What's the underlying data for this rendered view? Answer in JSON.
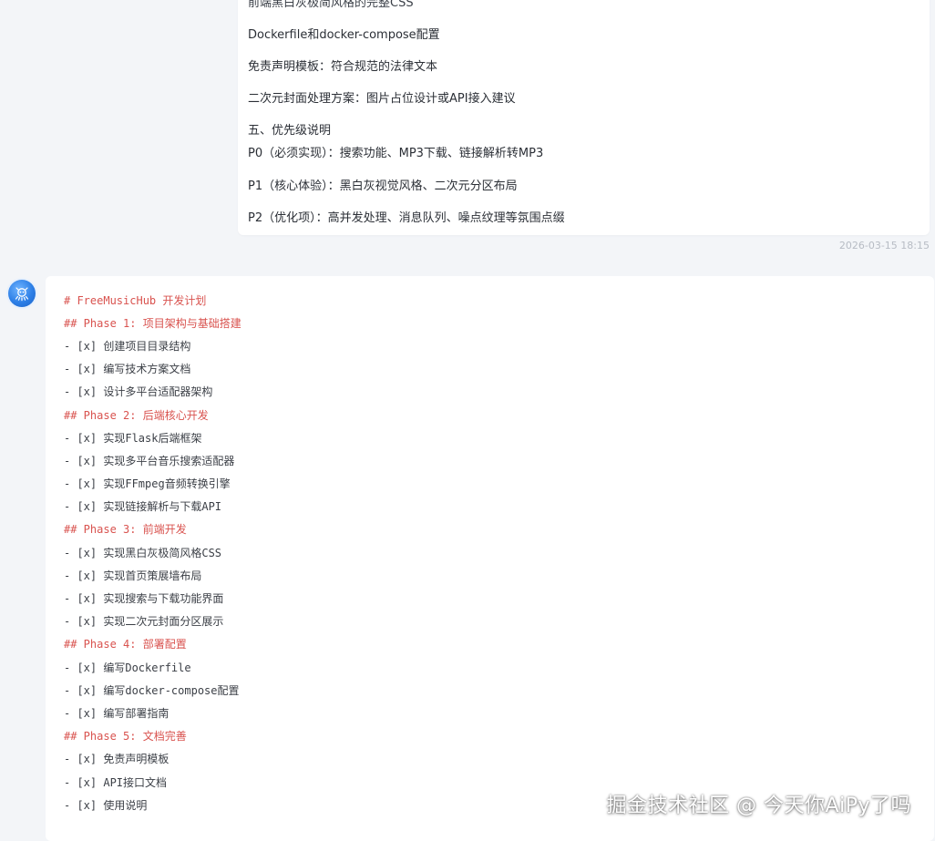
{
  "user_message": {
    "partial_top": "前端黑白灰极简风格的完整CSS",
    "lines": [
      "Dockerfile和docker-compose配置",
      "免责声明模板：符合规范的法律文本",
      "二次元封面处理方案：图片占位设计或API接入建议",
      "五、优先级说明",
      "P0（必须实现）：搜索功能、MP3下载、链接解析转MP3",
      "P1（核心体验）：黑白灰视觉风格、二次元分区布局",
      "P2（优化项）：高并发处理、消息队列、噪点纹理等氛围点缀"
    ],
    "timestamp": "2026-03-15 18:15"
  },
  "assistant_message": {
    "lines": [
      {
        "type": "heading",
        "text": "# FreeMusicHub 开发计划"
      },
      {
        "type": "heading",
        "text": "## Phase 1: 项目架构与基础搭建"
      },
      {
        "type": "task",
        "text": "- [x] 创建项目目录结构"
      },
      {
        "type": "task",
        "text": "- [x] 编写技术方案文档"
      },
      {
        "type": "task",
        "text": "- [x] 设计多平台适配器架构"
      },
      {
        "type": "heading",
        "text": "## Phase 2: 后端核心开发"
      },
      {
        "type": "task",
        "text": "- [x] 实现Flask后端框架"
      },
      {
        "type": "task",
        "text": "- [x] 实现多平台音乐搜索适配器"
      },
      {
        "type": "task",
        "text": "- [x] 实现FFmpeg音频转换引擎"
      },
      {
        "type": "task",
        "text": "- [x] 实现链接解析与下载API"
      },
      {
        "type": "heading",
        "text": "## Phase 3: 前端开发"
      },
      {
        "type": "task",
        "text": "- [x] 实现黑白灰极简风格CSS"
      },
      {
        "type": "task",
        "text": "- [x] 实现首页策展墙布局"
      },
      {
        "type": "task",
        "text": "- [x] 实现搜索与下载功能界面"
      },
      {
        "type": "task",
        "text": "- [x] 实现二次元封面分区展示"
      },
      {
        "type": "heading",
        "text": "## Phase 4: 部署配置"
      },
      {
        "type": "task",
        "text": "- [x] 编写Dockerfile"
      },
      {
        "type": "task",
        "text": "- [x] 编写docker-compose配置"
      },
      {
        "type": "task",
        "text": "- [x] 编写部署指南"
      },
      {
        "type": "heading",
        "text": "## Phase 5: 文档完善"
      },
      {
        "type": "task",
        "text": "- [x] 免责声明模板"
      },
      {
        "type": "task",
        "text": "- [x] API接口文档"
      },
      {
        "type": "task",
        "text": "- [x] 使用说明"
      }
    ]
  },
  "avatar_icon": "robot-avatar-icon",
  "watermark": "掘金技术社区 @ 今天你AiPy了吗",
  "colors": {
    "background": "#f3f5f8",
    "bubble": "#ffffff",
    "heading": "#d9534f",
    "task": "#3b3f46",
    "timestamp": "#b7bcc4",
    "avatar": "#2d7fe6"
  }
}
